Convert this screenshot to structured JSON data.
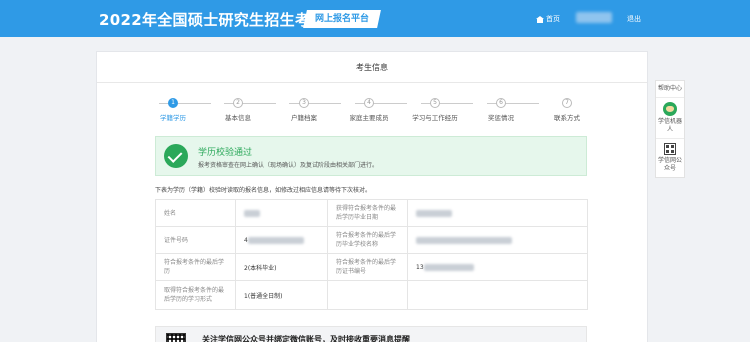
{
  "header": {
    "title": "2022年全国硕士研究生招生考试",
    "platform": "网上报名平台",
    "home_label": "首页",
    "logout_label": "退出"
  },
  "card": {
    "title": "考生信息"
  },
  "steps": [
    {
      "num": "1",
      "label": "学籍学历",
      "active": true
    },
    {
      "num": "2",
      "label": "基本信息",
      "active": false
    },
    {
      "num": "3",
      "label": "户籍档案",
      "active": false
    },
    {
      "num": "4",
      "label": "家庭主要成员",
      "active": false
    },
    {
      "num": "5",
      "label": "学习与工作经历",
      "active": false
    },
    {
      "num": "6",
      "label": "奖惩情况",
      "active": false
    },
    {
      "num": "7",
      "label": "联系方式",
      "active": false
    }
  ],
  "banner": {
    "title": "学历校验通过",
    "desc": "报考资格审查在网上确认（现场确认）及复试阶段由相关部门进行。"
  },
  "note": "下表为学历（学籍）校验时读取的报名信息，如修改过相应信息请等待下次核对。",
  "table": {
    "rows": [
      {
        "l1": "姓名",
        "v1": "",
        "l2": "获得符合报考条件的最后学历毕业日期",
        "v2": ""
      },
      {
        "l1": "证件号码",
        "v1": "4",
        "l2": "符合报考条件的最后学历毕业学校名称",
        "v2": ""
      },
      {
        "l1": "符合报考条件的最后学历",
        "v1": "2(本科毕业)",
        "l2": "符合报考条件的最后学历证书编号",
        "v2": "13"
      },
      {
        "l1": "取得符合报考条件的最后学历的学习形式",
        "v1": "1(普通全日制)",
        "l2": "",
        "v2": ""
      }
    ]
  },
  "wechat": {
    "text": "关注学信网公众号并绑定微信账号，及时接收重要消息提醒"
  },
  "side": {
    "help": "帮助中心",
    "robot": "学信机器人",
    "wechat": "学信网公众号"
  },
  "colors": {
    "primary": "#2f9ae6",
    "success": "#2ba85a"
  }
}
